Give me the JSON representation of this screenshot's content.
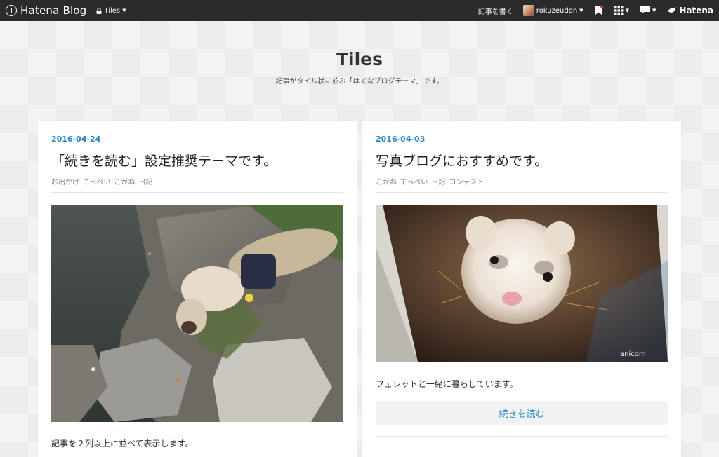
{
  "topbar": {
    "brand": "Hatena Blog",
    "blog_switch": "Tiles",
    "write_link": "記事を書く",
    "username": "rokuzeudon",
    "hatena_label": "Hatena"
  },
  "header": {
    "title": "Tiles",
    "description": "記事がタイル状に並ぶ「はてなブログテーマ」です。"
  },
  "posts": [
    {
      "date": "2016-04-24",
      "title": "「続きを読む」設定推奨テーマです。",
      "categories": [
        "お出かけ",
        "てっぺい",
        "こがね",
        "日記"
      ],
      "excerpt": "記事を２列以上に並べて表示します。"
    },
    {
      "date": "2016-04-03",
      "title": "写真ブログにおすすめです。",
      "categories": [
        "こがね",
        "てっぺい",
        "日記",
        "コンテスト"
      ],
      "excerpt": "フェレットと一緒に暮らしています。",
      "read_more": "続きを読む",
      "photo_watermark": "anicom"
    }
  ],
  "colors": {
    "accent": "#2a8ac7",
    "topbar": "#2b2b2b"
  }
}
